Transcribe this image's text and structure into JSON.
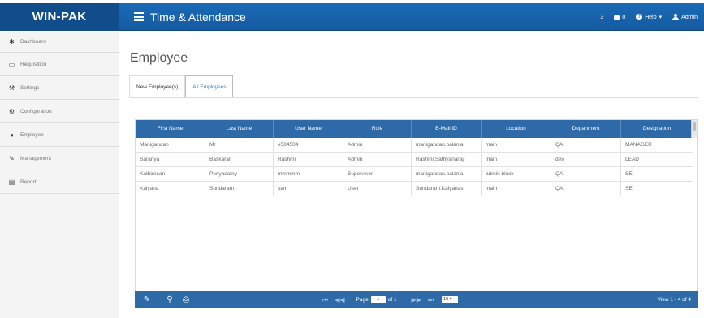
{
  "header": {
    "brand": "WIN-PAK",
    "title": "Time & Attendance",
    "count": "3",
    "notifications": "0",
    "help": "Help",
    "user": "Admin"
  },
  "sidebar": {
    "items": [
      {
        "label": "Dashboard",
        "icon": "dashboard-icon"
      },
      {
        "label": "Requisition",
        "icon": "monitor-icon"
      },
      {
        "label": "Settings",
        "icon": "wrench-icon"
      },
      {
        "label": "Configuration",
        "icon": "cogs-icon"
      },
      {
        "label": "Employee",
        "icon": "user-icon"
      },
      {
        "label": "Management",
        "icon": "edit-icon"
      },
      {
        "label": "Report",
        "icon": "report-icon"
      }
    ]
  },
  "main": {
    "page_title": "Employee",
    "tabs": [
      {
        "label": "New Employee(s)",
        "active": false
      },
      {
        "label": "All Employees",
        "active": true
      }
    ]
  },
  "grid": {
    "columns": [
      "First Name",
      "Last Name",
      "User Name",
      "Role",
      "E-Mail ID",
      "Location",
      "Department",
      "Designation"
    ],
    "rows": [
      [
        "Manigandan",
        "Mr",
        "e584504",
        "Admin",
        "manigandan.palania",
        "main",
        "QA",
        "MANAGER"
      ],
      [
        "Saranya",
        "Baskaran",
        "Rashmi",
        "Admin",
        "Rashmi.Sathyanaray",
        "main",
        "dev",
        "LEAD"
      ],
      [
        "Kathiresan",
        "Periyasamy",
        "mmmmm",
        "Supervisor",
        "manigandan.palania",
        "admin block",
        "QA",
        "SE"
      ],
      [
        "Kalyana",
        "Sundaram",
        "sam",
        "User",
        "Sundaram.Kalyanas",
        "main",
        "QA",
        "SE"
      ]
    ]
  },
  "pager": {
    "page_label": "Page",
    "page_value": "1",
    "of_label": "of 1",
    "page_size": "10",
    "view_text": "View 1 - 4 of 4"
  },
  "colors": {
    "topbar": "#1a6ab6",
    "brand_bg": "#114d8b",
    "grid_header": "#2f6aa8",
    "active_tab": "#3a87c8"
  }
}
